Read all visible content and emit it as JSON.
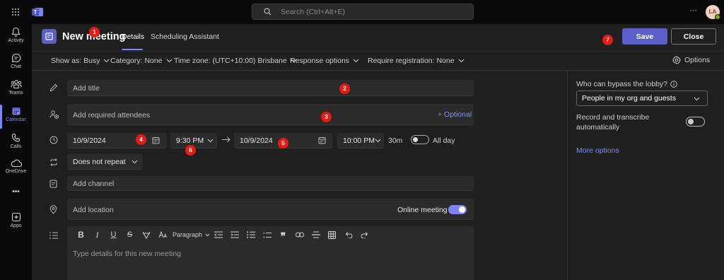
{
  "titlebar": {
    "search_placeholder": "Search (Ctrl+Alt+E)",
    "avatar_initials": "LA",
    "more_label": "···"
  },
  "rail": {
    "items": [
      {
        "label": "Activity",
        "icon": "bell-icon"
      },
      {
        "label": "Chat",
        "icon": "chat-icon"
      },
      {
        "label": "Teams",
        "icon": "teams-icon"
      },
      {
        "label": "Calendar",
        "icon": "calendar-icon",
        "active": true
      },
      {
        "label": "Calls",
        "icon": "phone-icon"
      },
      {
        "label": "OneDrive",
        "icon": "cloud-icon"
      },
      {
        "label": "•••",
        "icon": "more-icon"
      },
      {
        "label": "Apps",
        "icon": "add-apps-icon"
      }
    ]
  },
  "header": {
    "title": "New meeting",
    "tabs": [
      "Details",
      "Scheduling Assistant"
    ],
    "save_label": "Save",
    "close_label": "Close"
  },
  "options_bar": {
    "show_as": "Show as: Busy",
    "category": "Category: None",
    "time_zone": "Time zone: (UTC+10:00) Brisbane",
    "response_options": "Response options",
    "require_registration": "Require registration: None",
    "options": "Options"
  },
  "form": {
    "title_placeholder": "Add title",
    "attendees_placeholder": "Add required attendees",
    "optional_label": "+ Optional",
    "start_date": "10/9/2024",
    "start_time": "9:30 PM",
    "end_date": "10/9/2024",
    "end_time": "10:00 PM",
    "duration": "30m",
    "all_day": "All day",
    "repeat": "Does not repeat",
    "channel_placeholder": "Add channel",
    "location_placeholder": "Add location",
    "online_meeting": "Online meeting",
    "details_placeholder": "Type details for this new meeting",
    "paragraph_label": "Paragraph"
  },
  "right_panel": {
    "lobby_label": "Who can bypass the lobby?",
    "lobby_value": "People in my org and guests",
    "record_label": "Record and transcribe automatically",
    "more_options": "More options"
  },
  "badges": [
    "1",
    "2",
    "3",
    "4",
    "5",
    "6",
    "7"
  ],
  "colors": {
    "accent": "#5b5fc7",
    "accent_light": "#7f85f5",
    "badge": "#e41b17"
  }
}
